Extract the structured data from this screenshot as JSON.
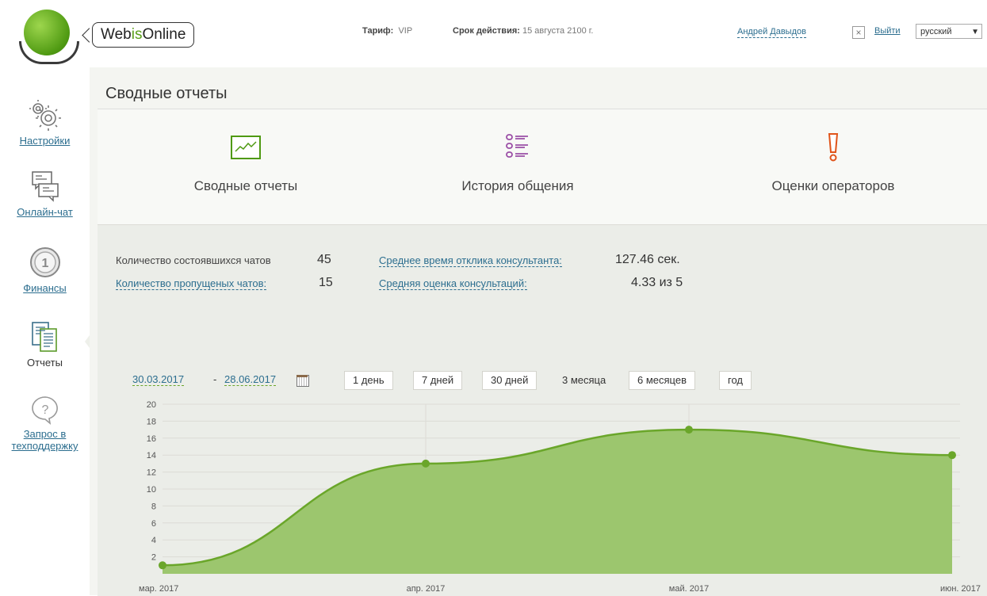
{
  "header": {
    "logo_text_pre": "Web",
    "logo_text_mid": "is",
    "logo_text_post": "Online",
    "tarif_label": "Тариф:",
    "tarif_value": "VIP",
    "expiry_label": "Срок действия:",
    "expiry_value": "15 августа 2100 г.",
    "user_name": "Андрей Давыдов",
    "close_glyph": "×",
    "logout_label": "Выйти",
    "language": "русский",
    "lang_arrow": "▼"
  },
  "sidebar": {
    "items": [
      {
        "label": "Настройки",
        "icon": "gears-icon"
      },
      {
        "label": "Онлайн-чат",
        "icon": "chat-icon"
      },
      {
        "label": "Финансы",
        "icon": "coin-icon"
      },
      {
        "label": "Отчеты",
        "icon": "reports-icon"
      },
      {
        "label": "Запрос в техподдержку",
        "icon": "question-icon"
      }
    ],
    "coin_digit": "1",
    "question_glyph": "?"
  },
  "main": {
    "title": "Сводные отчеты",
    "tabs": [
      {
        "label": "Сводные отчеты",
        "icon": "chart-icon"
      },
      {
        "label": "История общения",
        "icon": "list-icon"
      },
      {
        "label": "Оценки операторов",
        "icon": "exclamation-icon"
      }
    ]
  },
  "stats": {
    "chats_held_label": "Количество состоявшихся чатов",
    "chats_held_value": "45",
    "chats_missed_label": "Количество пропущеных чатов:",
    "chats_missed_value": "15",
    "avg_response_label": "Среднее время отклика консультанта:",
    "avg_response_value": "127.46 сек.",
    "avg_rating_label": "Средняя оценка консультаций:",
    "avg_rating_value": "4.33 из 5"
  },
  "range": {
    "from": "30.03.2017",
    "separator": "-",
    "to": "28.06.2017",
    "periods": [
      "1 день",
      "7 дней",
      "30 дней",
      "3 месяца",
      "6 месяцев",
      "год"
    ],
    "selected_index": 3
  },
  "colors": {
    "accent_green": "#6aa62a",
    "area_fill": "#9cc66e",
    "link_blue": "#2c6e8f"
  },
  "chart_data": {
    "type": "area",
    "categories": [
      "мар. 2017",
      "апр. 2017",
      "май. 2017",
      "июн. 2017"
    ],
    "values": [
      1,
      13,
      17,
      14
    ],
    "ylim": [
      0,
      20
    ],
    "yticks": [
      2,
      4,
      6,
      8,
      10,
      12,
      14,
      16,
      18,
      20
    ],
    "grid": true,
    "legend": "none"
  }
}
